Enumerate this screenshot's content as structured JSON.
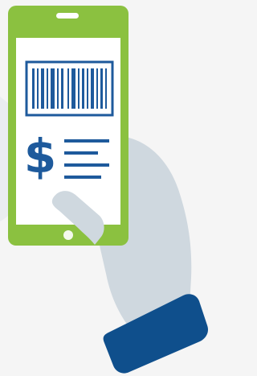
{
  "illustration": {
    "subject": "hand-holding-phone-icon",
    "elements": [
      "phone-icon",
      "barcode-icon",
      "dollar-sign-icon",
      "text-lines-icon",
      "hand-icon",
      "sleeve-cuff-icon"
    ]
  },
  "colors": {
    "background": "#f5f5f5",
    "phone_body": "#8bc140",
    "phone_screen": "#ffffff",
    "accent_blue": "#1e5a9c",
    "hand": "#cfd8df",
    "hand_shadow": "#b9c4cd",
    "cuff": "#0f4f8c"
  }
}
